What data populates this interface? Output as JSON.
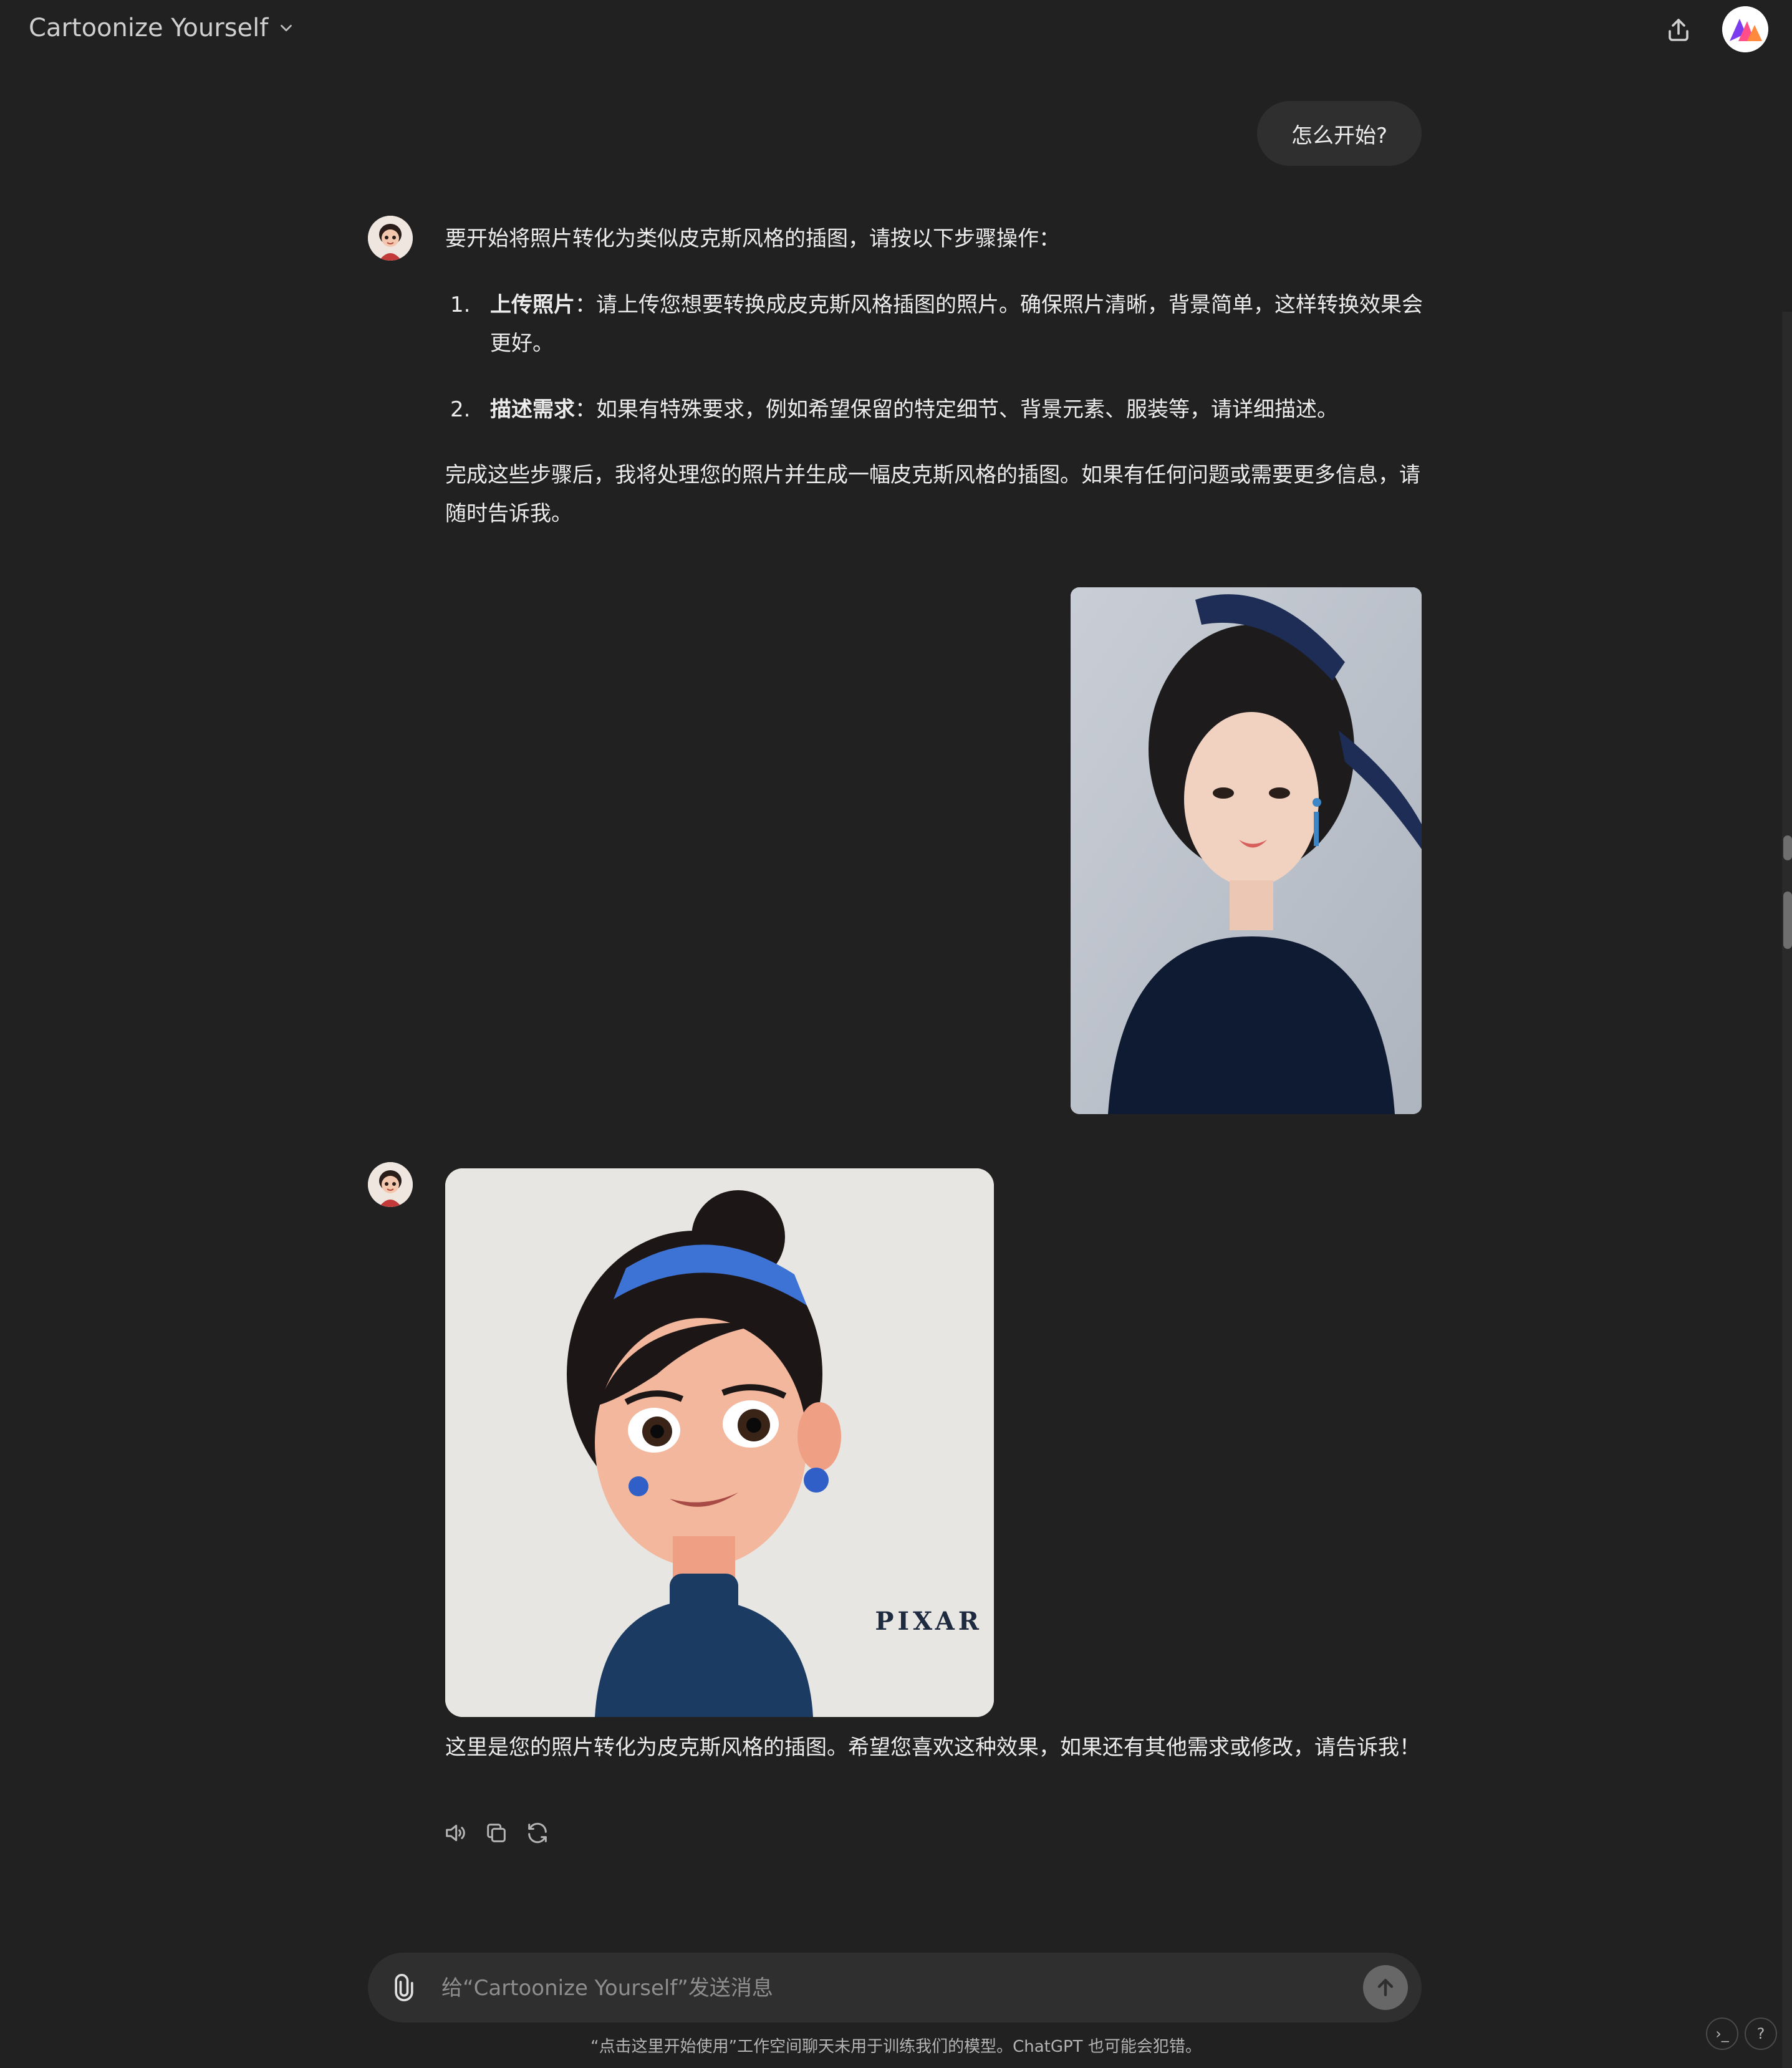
{
  "header": {
    "title": "Cartoonize Yourself"
  },
  "user_message": "怎么开始?",
  "assistant_reply_1": {
    "intro": "要开始将照片转化为类似皮克斯风格的插图，请按以下步骤操作：",
    "steps": [
      {
        "num": "1.",
        "bold": "上传照片",
        "text": "：请上传您想要转换成皮克斯风格插图的照片。确保照片清晰，背景简单，这样转换效果会更好。"
      },
      {
        "num": "2.",
        "bold": "描述需求",
        "text": "：如果有特殊要求，例如希望保留的特定细节、背景元素、服装等，请详细描述。"
      }
    ],
    "outro": "完成这些步骤后，我将处理您的照片并生成一幅皮克斯风格的插图。如果有任何问题或需要更多信息，请随时告诉我。"
  },
  "cartoon_watermark": "PIXAR",
  "assistant_reply_2": {
    "text": "这里是您的照片转化为皮克斯风格的插图。希望您喜欢这种效果，如果还有其他需求或修改，请告诉我！"
  },
  "composer": {
    "placeholder": "给“Cartoonize Yourself”发送消息"
  },
  "footer": "“点击这里开始使用”工作空间聊天未用于训练我们的模型。ChatGPT 也可能会犯错。",
  "corner_buttons": {
    "terminal": "›_",
    "help": "?"
  },
  "icons": {
    "title_chevron": "chevron-down-icon",
    "share": "share-icon",
    "read_aloud": "speaker-icon",
    "copy": "copy-icon",
    "regenerate": "refresh-icon",
    "attach": "paperclip-icon",
    "send": "arrow-up-icon"
  }
}
